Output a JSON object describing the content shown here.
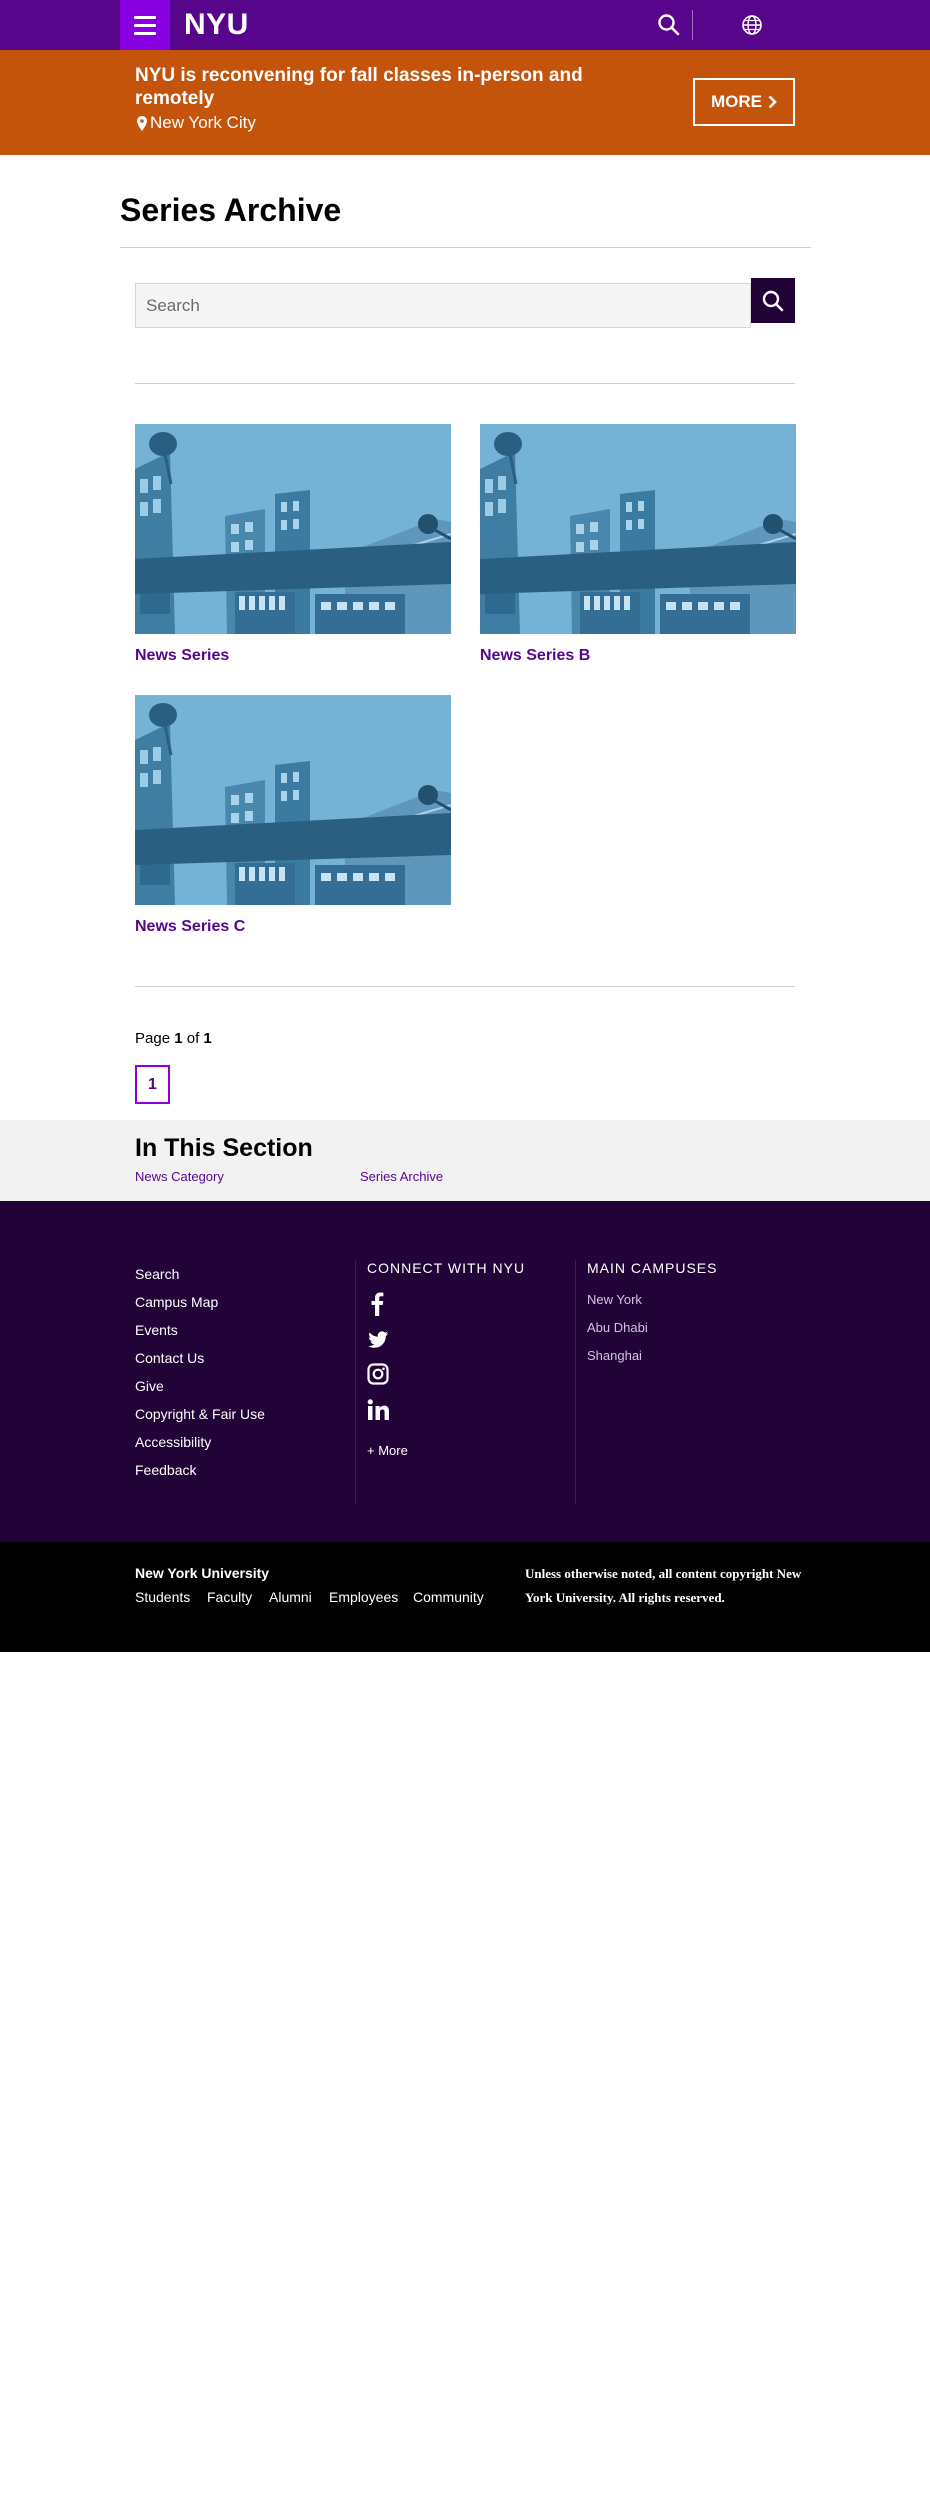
{
  "header": {
    "logo": "NYU",
    "menu_icon": "hamburger-menu-icon",
    "search_icon": "search-icon",
    "language_icon": "globe-icon",
    "bg_color": "#57068c",
    "menu_color": "#8900e1"
  },
  "alert": {
    "title": "NYU is reconvening for fall classes in-person and remotely",
    "location": "New York City",
    "location_icon": "map-pin-icon",
    "more_label": "MORE",
    "bg_color": "#c4530c"
  },
  "page": {
    "title": "Series Archive"
  },
  "search": {
    "placeholder": "Search",
    "value": ""
  },
  "cards": [
    {
      "title": "News Series"
    },
    {
      "title": "News Series B"
    },
    {
      "title": "News Series C"
    }
  ],
  "pagination": {
    "prefix": "Page",
    "current": "1",
    "middle": "of",
    "total": "1",
    "pages": [
      "1"
    ]
  },
  "in_this_section": {
    "title": "In This Section",
    "links": [
      "News Category",
      "Series Archive"
    ]
  },
  "footer": {
    "links": [
      "Search",
      "Campus Map",
      "Events",
      "Contact Us",
      "Give",
      "Copyright & Fair Use",
      "Accessibility",
      "Feedback"
    ],
    "connect_heading": "CONNECT WITH NYU",
    "social": [
      "facebook-icon",
      "twitter-icon",
      "instagram-icon",
      "linkedin-icon"
    ],
    "more_label": "+ More",
    "campuses_heading": "MAIN CAMPUSES",
    "campuses": [
      "New York",
      "Abu Dhabi",
      "Shanghai"
    ],
    "bg_color": "#220337"
  },
  "bottom": {
    "name": "New York University",
    "links": [
      "Students",
      "Faculty",
      "Alumni",
      "Employees",
      "Community"
    ],
    "copyright": "Unless otherwise noted, all content copyright New York University. All rights reserved."
  }
}
